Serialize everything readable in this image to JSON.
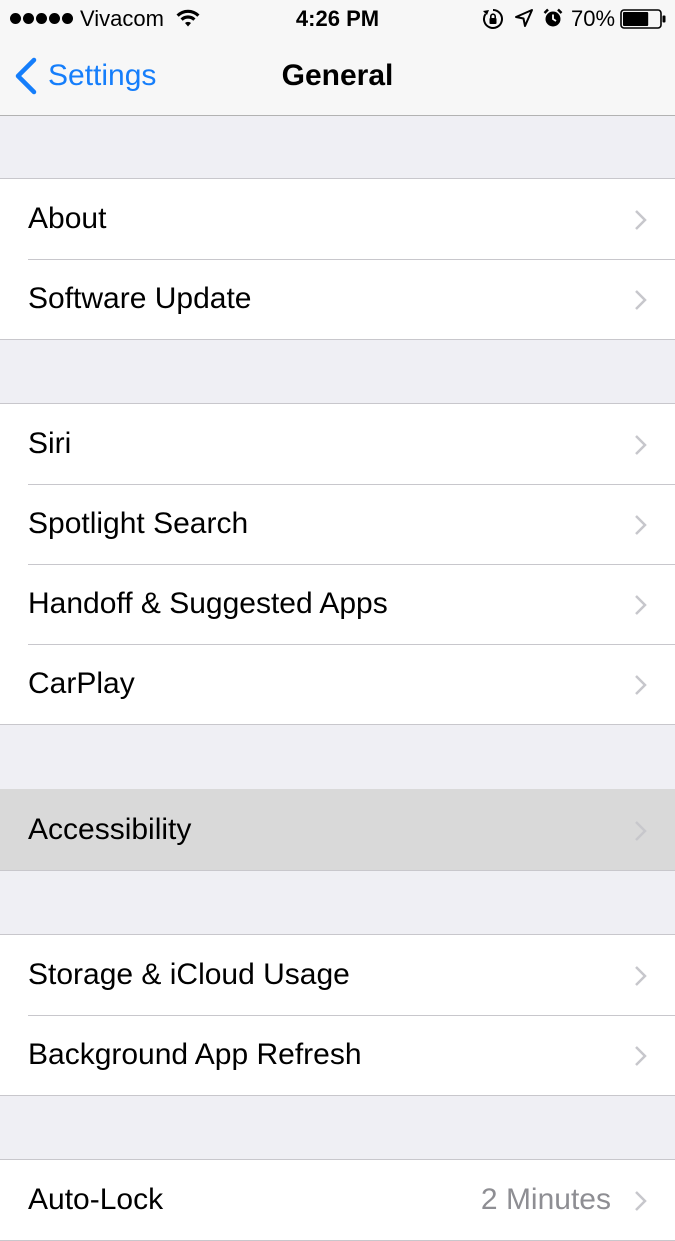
{
  "status_bar": {
    "carrier": "Vivacom",
    "time": "4:26 PM",
    "battery_percent": "70%",
    "battery_level": 0.7,
    "signal_bars": 5,
    "icons": [
      "wifi-icon",
      "orientation-lock-icon",
      "location-icon",
      "alarm-icon",
      "battery-icon"
    ]
  },
  "nav": {
    "back_label": "Settings",
    "title": "General"
  },
  "colors": {
    "accent": "#157efb",
    "background": "#efeff4",
    "row_highlight": "#d9d9d9",
    "separator": "#c8c7cc",
    "secondary_text": "#8e8e93"
  },
  "groups": [
    {
      "items": [
        {
          "label": "About"
        },
        {
          "label": "Software Update"
        }
      ]
    },
    {
      "items": [
        {
          "label": "Siri"
        },
        {
          "label": "Spotlight Search"
        },
        {
          "label": "Handoff & Suggested Apps"
        },
        {
          "label": "CarPlay"
        }
      ]
    },
    {
      "items": [
        {
          "label": "Accessibility",
          "highlighted": true
        }
      ]
    },
    {
      "items": [
        {
          "label": "Storage & iCloud Usage"
        },
        {
          "label": "Background App Refresh"
        }
      ]
    },
    {
      "items": [
        {
          "label": "Auto-Lock",
          "value": "2 Minutes"
        }
      ]
    }
  ]
}
